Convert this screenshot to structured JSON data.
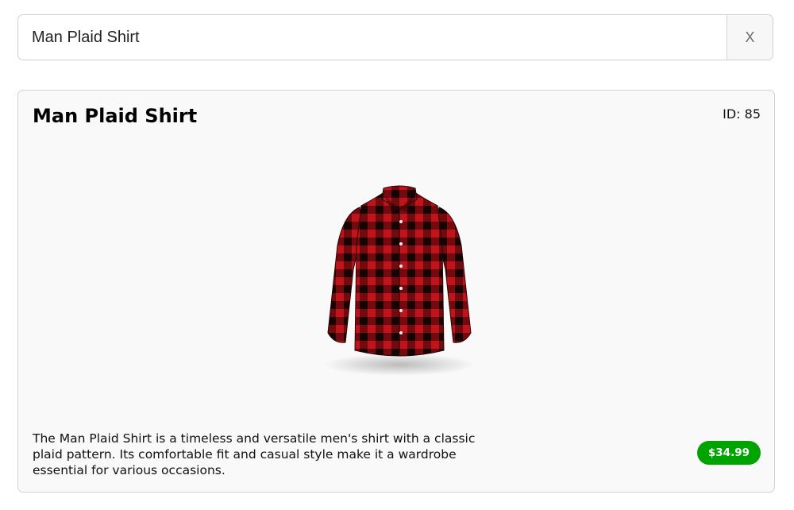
{
  "search": {
    "value": "Man Plaid Shirt",
    "clear_label": "X"
  },
  "product": {
    "title": "Man Plaid Shirt",
    "id_label": "ID: 85",
    "image": "red-black-plaid-shirt",
    "description": "The Man Plaid Shirt is a timeless and versatile men's shirt with a classic plaid pattern. Its comfortable fit and casual style make it a wardrobe essential for various occasions.",
    "price": "$34.99"
  },
  "colors": {
    "price_badge": "#00a400",
    "shirt_red": "#c0141c",
    "shirt_dark": "#1a0a0a"
  }
}
